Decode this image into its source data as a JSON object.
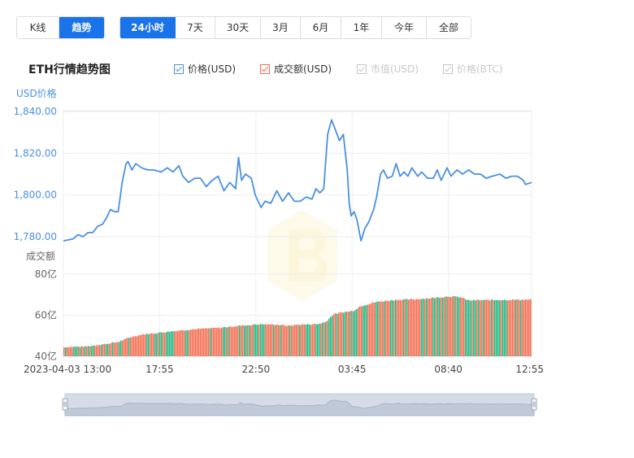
{
  "view_tabs": [
    {
      "label": "K线",
      "active": false
    },
    {
      "label": "趋势",
      "active": true
    }
  ],
  "range_tabs": [
    {
      "label": "24小时",
      "active": true
    },
    {
      "label": "7天",
      "active": false
    },
    {
      "label": "30天",
      "active": false
    },
    {
      "label": "3月",
      "active": false
    },
    {
      "label": "6月",
      "active": false
    },
    {
      "label": "1年",
      "active": false
    },
    {
      "label": "今年",
      "active": false
    },
    {
      "label": "全部",
      "active": false
    }
  ],
  "legend": [
    {
      "label": "价格(USD)",
      "checked": true,
      "color": "#4a90e2"
    },
    {
      "label": "成交额(USD)",
      "checked": true,
      "color": "#f26f52"
    },
    {
      "label": "市值(USD)",
      "checked": false,
      "color": "#c8c8c8"
    },
    {
      "label": "价格(BTC)",
      "checked": false,
      "color": "#c8c8c8"
    }
  ],
  "colors": {
    "accent": "#1a73e8",
    "price_line": "#4a90e2",
    "volume_up": "#27b883",
    "volume_down": "#f26f52"
  },
  "chart_data": {
    "type": "line",
    "title": "ETH行情趋势图",
    "price_axis": {
      "label": "USD价格",
      "ylim": [
        1774,
        1840
      ],
      "ticks": [
        "1,840.00",
        "1,820.00",
        "1,800.00",
        "1,780.00"
      ],
      "tick_values": [
        1840,
        1820,
        1800,
        1780
      ]
    },
    "volume_axis": {
      "label": "成交额",
      "ylim": [
        40,
        80
      ],
      "ticks": [
        "80亿",
        "60亿",
        "40亿"
      ],
      "tick_values": [
        80,
        60,
        40
      ]
    },
    "x_ticks": [
      "2023-04-03 13:00",
      "17:55",
      "22:50",
      "03:45",
      "08:40",
      "12:55"
    ],
    "x_tick_hours": [
      0,
      4.9167,
      9.8333,
      14.75,
      19.6667,
      23.9167
    ],
    "x_range_hours": [
      0,
      23.9167
    ],
    "series": [
      {
        "name": "价格(USD)",
        "points": [
          [
            0,
            1778
          ],
          [
            0.5,
            1779
          ],
          [
            0.75,
            1781
          ],
          [
            1.0,
            1780
          ],
          [
            1.25,
            1782
          ],
          [
            1.5,
            1782
          ],
          [
            1.75,
            1785
          ],
          [
            2.0,
            1786
          ],
          [
            2.2,
            1789
          ],
          [
            2.4,
            1793
          ],
          [
            2.6,
            1792
          ],
          [
            2.8,
            1792
          ],
          [
            3.0,
            1806
          ],
          [
            3.2,
            1815
          ],
          [
            3.3,
            1816
          ],
          [
            3.5,
            1812
          ],
          [
            3.7,
            1815
          ],
          [
            4.0,
            1813
          ],
          [
            4.3,
            1812
          ],
          [
            4.6,
            1812
          ],
          [
            5.0,
            1811
          ],
          [
            5.3,
            1813
          ],
          [
            5.6,
            1811
          ],
          [
            5.9,
            1814
          ],
          [
            6.1,
            1809
          ],
          [
            6.4,
            1806
          ],
          [
            6.7,
            1808
          ],
          [
            7.0,
            1808
          ],
          [
            7.3,
            1804
          ],
          [
            7.6,
            1807
          ],
          [
            7.9,
            1809
          ],
          [
            8.2,
            1802
          ],
          [
            8.5,
            1806
          ],
          [
            8.8,
            1803
          ],
          [
            8.95,
            1818
          ],
          [
            9.1,
            1807
          ],
          [
            9.3,
            1810
          ],
          [
            9.6,
            1808
          ],
          [
            9.8,
            1800
          ],
          [
            10.1,
            1794
          ],
          [
            10.3,
            1797
          ],
          [
            10.6,
            1796
          ],
          [
            10.9,
            1802
          ],
          [
            11.2,
            1797
          ],
          [
            11.5,
            1801
          ],
          [
            11.8,
            1797
          ],
          [
            12.1,
            1797
          ],
          [
            12.4,
            1799
          ],
          [
            12.7,
            1798
          ],
          [
            12.9,
            1803
          ],
          [
            13.1,
            1801
          ],
          [
            13.3,
            1803
          ],
          [
            13.5,
            1829
          ],
          [
            13.7,
            1836
          ],
          [
            13.9,
            1831
          ],
          [
            14.1,
            1826
          ],
          [
            14.3,
            1829
          ],
          [
            14.5,
            1812
          ],
          [
            14.6,
            1796
          ],
          [
            14.7,
            1790
          ],
          [
            14.85,
            1792
          ],
          [
            15.0,
            1788
          ],
          [
            15.2,
            1778
          ],
          [
            15.4,
            1784
          ],
          [
            15.6,
            1787
          ],
          [
            15.85,
            1793
          ],
          [
            16.0,
            1799
          ],
          [
            16.2,
            1810
          ],
          [
            16.35,
            1812
          ],
          [
            16.55,
            1808
          ],
          [
            16.8,
            1809
          ],
          [
            17.0,
            1815
          ],
          [
            17.2,
            1809
          ],
          [
            17.4,
            1811
          ],
          [
            17.6,
            1809
          ],
          [
            17.8,
            1813
          ],
          [
            18.1,
            1809
          ],
          [
            18.3,
            1811
          ],
          [
            18.6,
            1808
          ],
          [
            18.9,
            1808
          ],
          [
            19.1,
            1812
          ],
          [
            19.3,
            1807
          ],
          [
            19.6,
            1813
          ],
          [
            19.8,
            1809
          ],
          [
            20.1,
            1812
          ],
          [
            20.4,
            1810
          ],
          [
            20.7,
            1812
          ],
          [
            21.0,
            1810
          ],
          [
            21.3,
            1810
          ],
          [
            21.6,
            1808
          ],
          [
            21.9,
            1809
          ],
          [
            22.3,
            1810
          ],
          [
            22.6,
            1808
          ],
          [
            22.9,
            1809
          ],
          [
            23.2,
            1809
          ],
          [
            23.5,
            1807
          ],
          [
            23.6,
            1805
          ],
          [
            23.9167,
            1806
          ]
        ]
      },
      {
        "name": "成交额(USD)",
        "bars_anchor": [
          [
            0,
            44.5
          ],
          [
            1.2,
            44.8
          ],
          [
            2.0,
            45.8
          ],
          [
            2.8,
            47
          ],
          [
            3.4,
            49.2
          ],
          [
            4.0,
            50.6
          ],
          [
            5.0,
            51.6
          ],
          [
            6.0,
            52.7
          ],
          [
            7.0,
            53.4
          ],
          [
            8.0,
            53.9
          ],
          [
            9.0,
            54.9
          ],
          [
            10.0,
            55.6
          ],
          [
            10.8,
            55.5
          ],
          [
            11.5,
            54.9
          ],
          [
            12.0,
            55.4
          ],
          [
            13.0,
            55.7
          ],
          [
            13.4,
            56.7
          ],
          [
            13.8,
            60.5
          ],
          [
            14.3,
            61.5
          ],
          [
            14.8,
            62.1
          ],
          [
            15.2,
            64.5
          ],
          [
            16.0,
            66.5
          ],
          [
            17.0,
            67.5
          ],
          [
            18.0,
            67.8
          ],
          [
            19.0,
            68.5
          ],
          [
            19.7,
            69.2
          ],
          [
            20.3,
            68.8
          ],
          [
            20.7,
            67.2
          ],
          [
            21.5,
            67.4
          ],
          [
            23.9167,
            67.6
          ]
        ]
      }
    ]
  }
}
